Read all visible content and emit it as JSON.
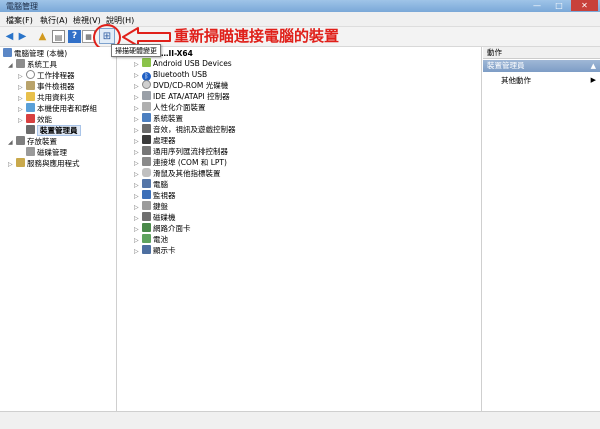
{
  "window": {
    "title": "電腦管理"
  },
  "menu": [
    {
      "label": "檔案(F)"
    },
    {
      "label": "執行(A)"
    },
    {
      "label": "檢視(V)"
    },
    {
      "label": "說明(H)"
    }
  ],
  "toolbar": {
    "tooltip": "掃描硬體變更"
  },
  "annotation": {
    "text": "重新掃瞄連接電腦的裝置",
    "color": "#e0201a"
  },
  "left_tree": [
    {
      "label": "電腦管理 (本機)",
      "icon": "computer-icon",
      "expander": "",
      "indent": 0
    },
    {
      "label": "系統工具",
      "icon": "tools-icon",
      "expander": "◢",
      "indent": 1
    },
    {
      "label": "工作排程器",
      "icon": "clock-icon",
      "expander": "▷",
      "indent": 2
    },
    {
      "label": "事件檢視器",
      "icon": "event-viewer-icon",
      "expander": "▷",
      "indent": 2
    },
    {
      "label": "共用資料夾",
      "icon": "shared-folder-icon",
      "expander": "▷",
      "indent": 2
    },
    {
      "label": "本機使用者和群組",
      "icon": "users-icon",
      "expander": "▷",
      "indent": 2
    },
    {
      "label": "效能",
      "icon": "performance-icon",
      "expander": "▷",
      "indent": 2
    },
    {
      "label": "裝置管理員",
      "icon": "device-manager-icon",
      "expander": "",
      "indent": 2,
      "selected": true
    },
    {
      "label": "存放裝置",
      "icon": "storage-icon",
      "expander": "◢",
      "indent": 1
    },
    {
      "label": "磁碟管理",
      "icon": "disk-management-icon",
      "expander": "",
      "indent": 2
    },
    {
      "label": "服務與應用程式",
      "icon": "services-icon",
      "expander": "▷",
      "indent": 1
    }
  ],
  "device_tree": {
    "root": "…II-X64",
    "items": [
      {
        "label": "Android USB Devices",
        "icon": "android-icon"
      },
      {
        "label": "Bluetooth USB",
        "icon": "bluetooth-icon"
      },
      {
        "label": "DVD/CD-ROM 光碟機",
        "icon": "dvd-icon"
      },
      {
        "label": "IDE ATA/ATAPI 控制器",
        "icon": "ide-controller-icon"
      },
      {
        "label": "人性化介面裝置",
        "icon": "hid-icon"
      },
      {
        "label": "系統裝置",
        "icon": "system-device-icon"
      },
      {
        "label": "音效，視訊及遊戲控制器",
        "icon": "audio-icon"
      },
      {
        "label": "處理器",
        "icon": "processor-icon"
      },
      {
        "label": "通用序列匯流排控制器",
        "icon": "usb-icon"
      },
      {
        "label": "連接埠 (COM 和 LPT)",
        "icon": "port-icon"
      },
      {
        "label": "滑鼠及其他指標裝置",
        "icon": "mouse-icon"
      },
      {
        "label": "電腦",
        "icon": "computer-device-icon"
      },
      {
        "label": "監視器",
        "icon": "monitor-icon"
      },
      {
        "label": "鍵盤",
        "icon": "keyboard-icon"
      },
      {
        "label": "磁碟機",
        "icon": "disk-drive-icon"
      },
      {
        "label": "網路介面卡",
        "icon": "network-adapter-icon"
      },
      {
        "label": "電池",
        "icon": "battery-icon"
      },
      {
        "label": "顯示卡",
        "icon": "display-adapter-icon"
      }
    ]
  },
  "actions_pane": {
    "header": "動作",
    "group": "裝置管理員",
    "item": "其他動作"
  }
}
